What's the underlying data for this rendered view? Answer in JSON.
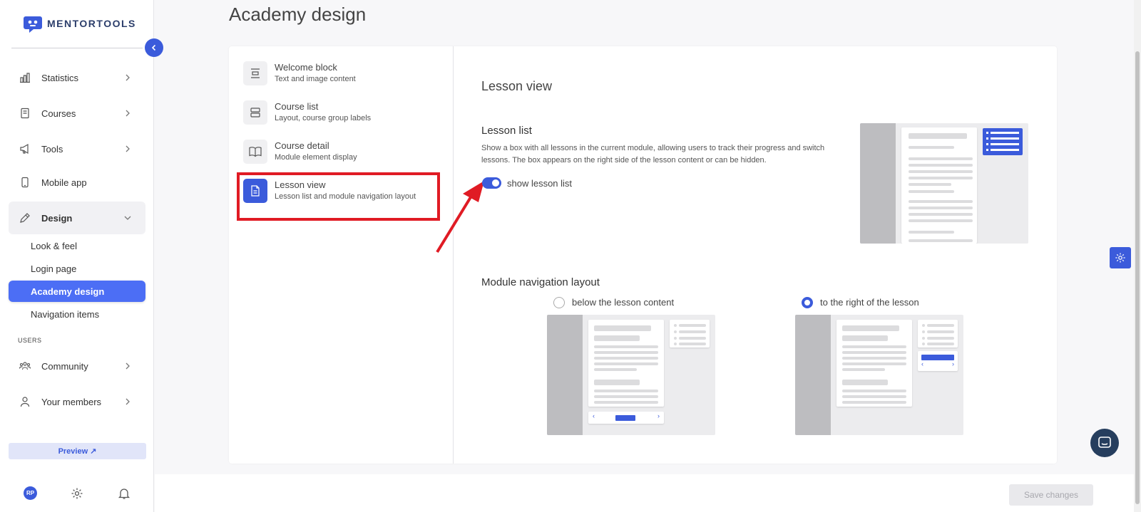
{
  "app": {
    "brand": "MENTORTOOLS"
  },
  "sidebar": {
    "items": [
      {
        "label": "Statistics",
        "icon": "bar-chart-icon"
      },
      {
        "label": "Courses",
        "icon": "book-icon"
      },
      {
        "label": "Tools",
        "icon": "megaphone-icon"
      },
      {
        "label": "Mobile app",
        "icon": "mobile-icon"
      },
      {
        "label": "Design",
        "icon": "pencil-icon"
      }
    ],
    "design_sub": [
      {
        "label": "Look & feel"
      },
      {
        "label": "Login page"
      },
      {
        "label": "Academy design"
      },
      {
        "label": "Navigation items"
      }
    ],
    "section_users": "USERS",
    "users_items": [
      {
        "label": "Community",
        "icon": "people-icon"
      },
      {
        "label": "Your members",
        "icon": "user-icon"
      }
    ],
    "preview_label": "Preview ↗",
    "avatar_initials": "RP"
  },
  "page": {
    "title": "Academy design"
  },
  "menu": [
    {
      "title": "Welcome block",
      "subtitle": "Text and image content",
      "icon": "align-center-icon"
    },
    {
      "title": "Course list",
      "subtitle": "Layout, course group labels",
      "icon": "rows-icon"
    },
    {
      "title": "Course detail",
      "subtitle": "Module element display",
      "icon": "open-book-icon"
    },
    {
      "title": "Lesson view",
      "subtitle": "Lesson list and module navigation layout",
      "icon": "document-icon"
    }
  ],
  "panel": {
    "heading": "Lesson view",
    "lesson_list": {
      "title": "Lesson list",
      "description": "Show a box with all lessons in the current module, allowing users to track their progress and switch lessons. The box appears on the right side of the lesson content or can be hidden.",
      "toggle_label": "show lesson list",
      "toggle_on": true
    },
    "module_nav": {
      "title": "Module navigation layout",
      "options": [
        {
          "label": "below the lesson content",
          "selected": false
        },
        {
          "label": "to the right of the lesson",
          "selected": true
        }
      ]
    }
  },
  "actions": {
    "save_label": "Save changes"
  },
  "colors": {
    "accent": "#3b5bdb",
    "highlight": "#e01b24",
    "chat": "#263e5e"
  }
}
